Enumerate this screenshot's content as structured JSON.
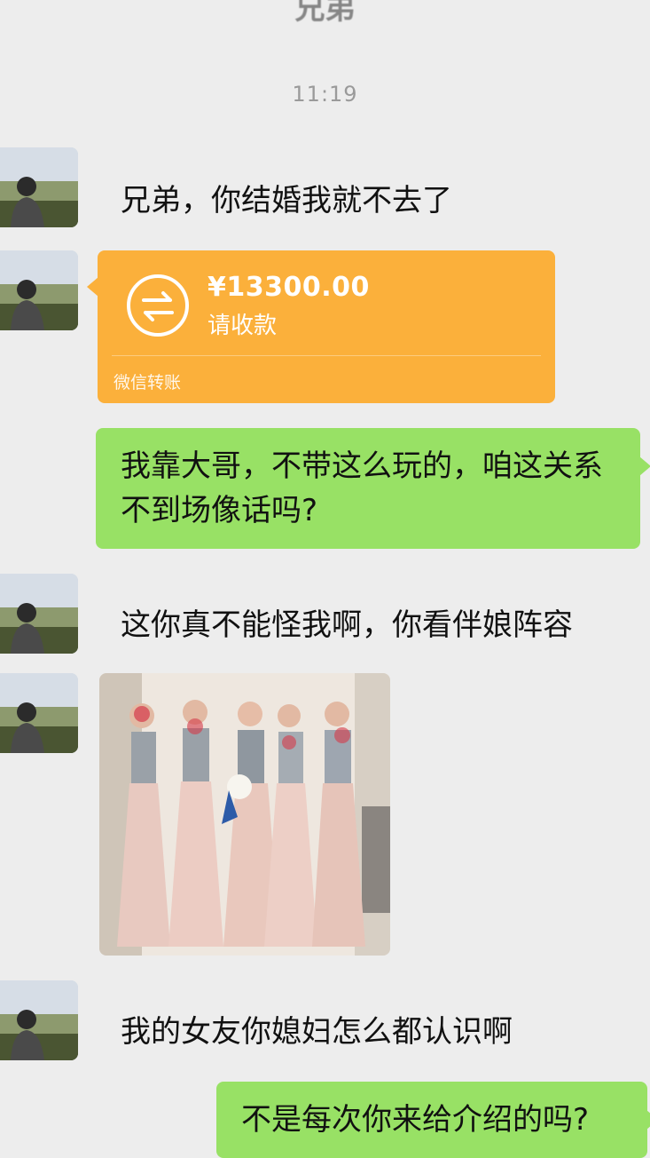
{
  "header": {
    "title": "兄弟"
  },
  "timestamp": "11:19",
  "messages": {
    "m1": "兄弟，你结婚我就不去了",
    "transfer": {
      "amount": "¥13300.00",
      "status": "请收款",
      "footer": "微信转账",
      "color": "#fbb03b"
    },
    "m3": "我靠大哥，不带这么玩的，咱这关系不到场像话吗?",
    "m4": "这你真不能怪我啊，你看伴娘阵容",
    "m6": "我的女友你媳妇怎么都认识啊",
    "m7": "不是每次你来给介绍的吗?"
  },
  "colors": {
    "background": "#ededed",
    "outgoing_bubble": "#98e165",
    "transfer_card": "#fbb03b"
  },
  "icons": [
    "avatar-image",
    "transfer-arrows-icon",
    "bridesmaids-photo"
  ]
}
